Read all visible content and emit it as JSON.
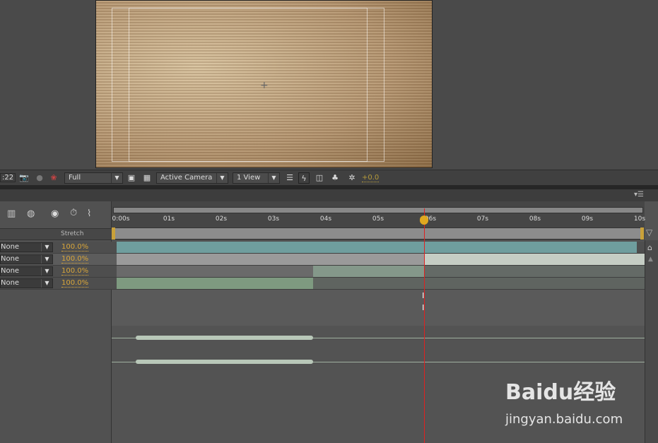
{
  "viewer": {
    "timecode": ":22",
    "resolution": "Full",
    "camera": "Active Camera",
    "views": "1 View",
    "exposure": "+0.0"
  },
  "timeline": {
    "column_stretch": "Stretch",
    "ticks": [
      "0:00s",
      "01s",
      "02s",
      "03s",
      "04s",
      "05s",
      "06s",
      "07s",
      "08s",
      "09s",
      "10s"
    ],
    "playhead_seconds": 5.88,
    "layers": [
      {
        "parent": "None",
        "stretch": "100.0%"
      },
      {
        "parent": "None",
        "stretch": "100.0%"
      },
      {
        "parent": "None",
        "stretch": "100.0%"
      },
      {
        "parent": "None",
        "stretch": "100.0%"
      }
    ],
    "colors": {
      "teal": "#6f9e9e",
      "green": "#7e9a80",
      "playhead": "#e02020",
      "accent": "#d9a63a"
    }
  },
  "watermark": {
    "brand": "Baidu经验",
    "url": "jingyan.baidu.com"
  }
}
